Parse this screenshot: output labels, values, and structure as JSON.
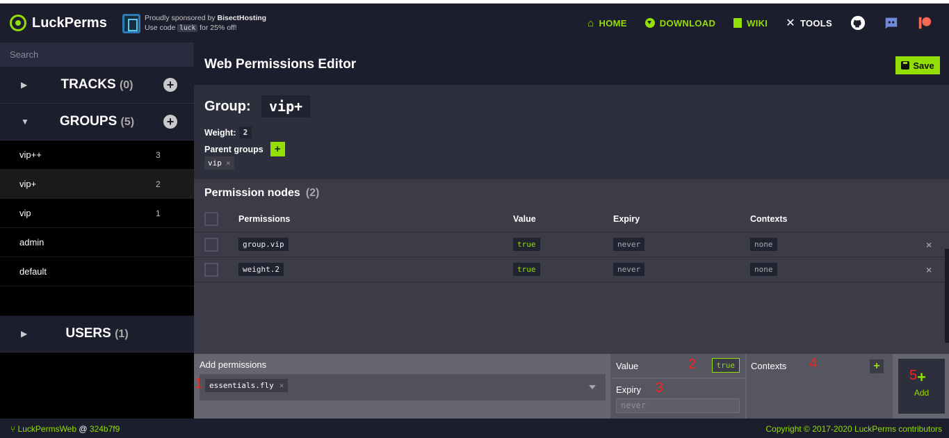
{
  "brand": {
    "name": "LuckPerms"
  },
  "sponsor": {
    "line1_prefix": "Proudly sponsored by ",
    "line1_brand": "BisectHosting",
    "line2_prefix": "Use code ",
    "code": "luck",
    "line2_suffix": " for 25% off!"
  },
  "nav": {
    "home": "HOME",
    "download": "DOWNLOAD",
    "wiki": "WIKI",
    "tools": "TOOLS"
  },
  "sidebar": {
    "search_placeholder": "Search",
    "tracks": {
      "label": "TRACKS",
      "count": "(0)"
    },
    "groups": {
      "label": "GROUPS",
      "count": "(5)"
    },
    "users": {
      "label": "USERS",
      "count": "(1)"
    },
    "group_items": [
      {
        "name": "vip++",
        "weight": "3"
      },
      {
        "name": "vip+",
        "weight": "2"
      },
      {
        "name": "vip",
        "weight": "1"
      },
      {
        "name": "admin",
        "weight": ""
      },
      {
        "name": "default",
        "weight": ""
      }
    ]
  },
  "editor": {
    "title": "Web Permissions Editor",
    "save_label": "Save",
    "group_label": "Group:",
    "group_name": "vip+",
    "weight_label": "Weight:",
    "weight_value": "2",
    "parents_label": "Parent groups",
    "parent_add": "+",
    "parent": "vip",
    "remove_glyph": "×"
  },
  "nodes": {
    "title": "Permission nodes",
    "count": "(2)",
    "headers": {
      "permissions": "Permissions",
      "value": "Value",
      "expiry": "Expiry",
      "contexts": "Contexts"
    },
    "rows": [
      {
        "permission": "group.vip",
        "value": "true",
        "expiry": "never",
        "contexts": "none",
        "delete": "×"
      },
      {
        "permission": "weight.2",
        "value": "true",
        "expiry": "never",
        "contexts": "none",
        "delete": "×"
      }
    ]
  },
  "add_panel": {
    "add_label": "Add permissions",
    "perm_tag": "essentials.fly",
    "value_label": "Value",
    "value": "true",
    "expiry_label": "Expiry",
    "expiry_placeholder": "never",
    "contexts_label": "Contexts",
    "contexts_add": "+",
    "add_button_icon": "+",
    "add_button": "Add",
    "annotations": [
      "1",
      "2",
      "3",
      "4",
      "5"
    ]
  },
  "footer": {
    "app": "LuckPermsWeb",
    "at": "@",
    "commit": "324b7f9",
    "copyright": "Copyright © 2017-2020 LuckPerms contributors"
  },
  "colors": {
    "accent": "#94df03",
    "topbar": "#1d1e2d",
    "panel": "#3b3c48",
    "annotation": "#ff1f1f"
  }
}
